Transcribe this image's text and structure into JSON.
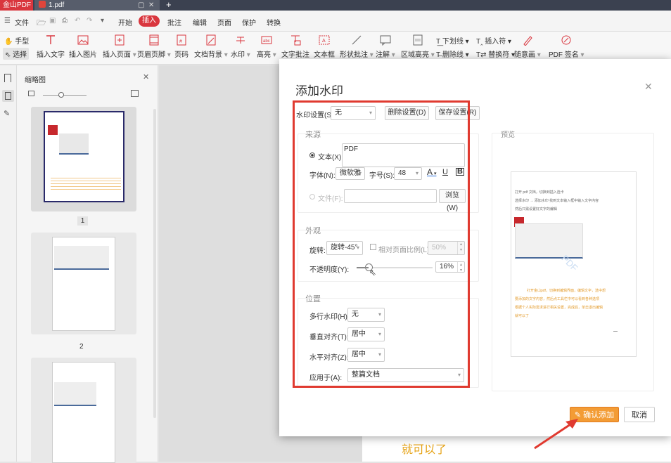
{
  "titlebar": {
    "app_name": "金山PDF",
    "doc_tab": "1.pdf"
  },
  "menu": {
    "file": "文件",
    "items": [
      "开始",
      "插入",
      "批注",
      "编辑",
      "页面",
      "保护",
      "转换"
    ]
  },
  "toolbar": {
    "hand": "手型",
    "select": "选择",
    "tools": [
      "插入文字",
      "插入图片",
      "插入页面",
      "页眉页脚",
      "页码",
      "文档背景",
      "水印",
      "高亮",
      "文字批注",
      "文本框",
      "形状批注",
      "注解",
      "区域高亮",
      "随意画",
      "PDF 签名"
    ],
    "small_tools": [
      "下划线",
      "删除线",
      "插入符",
      "替换符"
    ]
  },
  "thumbpanel": {
    "title": "缩略图",
    "pages": [
      "1",
      "2"
    ]
  },
  "dialog": {
    "title": "添加水印",
    "settings_label": "水印设置(S):",
    "settings_value": "无",
    "delete_btn": "删除设置(D)",
    "save_btn": "保存设置(R)",
    "source_section": "来源",
    "text_radio": "文本(X):",
    "text_value": "PDF",
    "font_label": "字体(N):",
    "font_value": "微软雅",
    "size_label": "字号(S):",
    "size_value": "48",
    "underline": "U",
    "bold": "B",
    "color_a": "A",
    "file_radio": "文件(F):",
    "browse_btn": "浏览(W)",
    "appearance_section": "外观",
    "rotate_label": "旋转:",
    "rotate_value": "旋转-45°",
    "ratio_label": "相对页面比例(L):",
    "ratio_value": "50%",
    "opacity_label": "不透明度(Y):",
    "opacity_value": "16%",
    "opacity_fraction": 0.16,
    "position_section": "位置",
    "multi_label": "多行水印(H):",
    "multi_value": "无",
    "valign_label": "垂直对齐(T):",
    "valign_value": "居中",
    "halign_label": "水平对齐(Z):",
    "halign_value": "居中",
    "apply_label": "应用于(A):",
    "apply_value": "整篇文档",
    "preview_section": "预览",
    "confirm_btn": "确认添加",
    "cancel_btn": "取消"
  },
  "annotation": {
    "text": "就可以了"
  },
  "preview": {
    "line1": "打开 pdf 文档，切换到插入选卡",
    "line2": "选择水印 → 添加水印 找到文本输入框中输入文字内容",
    "line3": "然后只需设置好文字的编辑",
    "watermark": "PDF",
    "orange1": "打开金山pdf，切换到编辑界面，编辑文字，选中想",
    "orange2": "要添加的文字内容，然后点工具栏中可以看到各种选项",
    "orange3": "根据个人实际需求进行相关设置，完成后，单击退出编辑",
    "orange4": "就可以了"
  },
  "colors": {
    "accent": "#d9363e",
    "confirm": "#f39c35",
    "annotation": "#e6a317",
    "frame": "#e03a30"
  }
}
